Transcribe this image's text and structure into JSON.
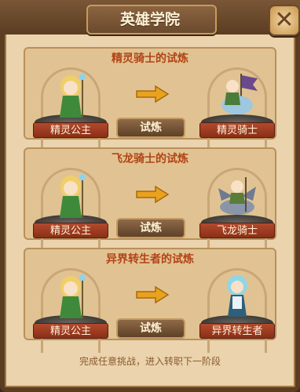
{
  "window": {
    "title": "英雄学院",
    "close_glyph": "✕",
    "close_icon": "close-icon"
  },
  "trials": [
    {
      "title": "精灵骑士的试炼",
      "from_label": "精灵公主",
      "button_label": "试炼",
      "to_label": "精灵骑士"
    },
    {
      "title": "飞龙骑士的试炼",
      "from_label": "精灵公主",
      "button_label": "试炼",
      "to_label": "飞龙骑士"
    },
    {
      "title": "异界转生者的试炼",
      "from_label": "精灵公主",
      "button_label": "试炼",
      "to_label": "异界转生者"
    }
  ],
  "footer": {
    "hint": "完成任意挑战，进入转职下一阶段"
  },
  "colors": {
    "panel_title": "#b14416",
    "arrow": "#e8a21e",
    "ribbon": "#b24a2c"
  }
}
